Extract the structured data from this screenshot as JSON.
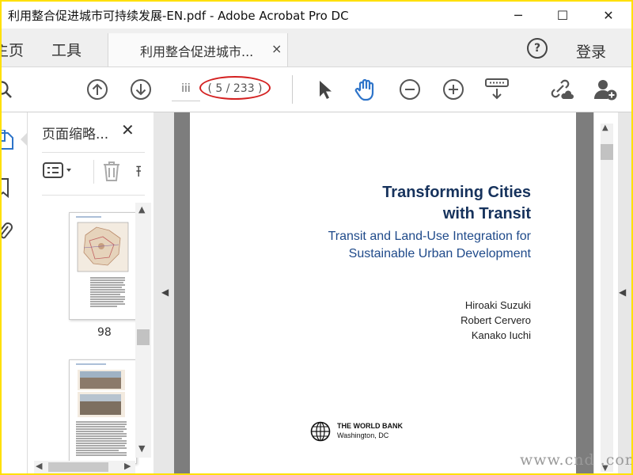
{
  "window": {
    "title": "利用整合促进城市可持续发展-EN.pdf - Adobe Acrobat Pro DC",
    "minimize_glyph": "─",
    "maximize_glyph": "☐",
    "close_glyph": "✕"
  },
  "tabs": {
    "home_label": "主页",
    "tools_label": "工具",
    "document_label": "利用整合促进城市...",
    "document_close_glyph": "×",
    "help_glyph": "?",
    "login_label": "登录"
  },
  "toolbar": {
    "current_page": "iii",
    "page_count": "( 5 / 233 )",
    "icons": [
      "search-icon",
      "page-up-icon",
      "page-down-icon",
      "select-cursor-icon",
      "hand-tool-icon",
      "zoom-out-icon",
      "zoom-in-icon",
      "scroll-mode-icon",
      "link-cloud-icon",
      "add-user-icon"
    ]
  },
  "thumbnail_panel": {
    "title": "页面缩略...",
    "close_glyph": "✕",
    "thumbnails": [
      {
        "page_label": "98"
      },
      {
        "page_label": ""
      }
    ]
  },
  "document": {
    "title_line1": "Transforming Cities",
    "title_line2": "with Transit",
    "subtitle_line1": "Transit and Land-Use Integration for",
    "subtitle_line2": "Sustainable Urban Development",
    "authors": [
      "Hiroaki Suzuki",
      "Robert Cervero",
      "Kanako Iuchi"
    ],
    "publisher": "THE WORLD BANK",
    "publisher_city": "Washington, DC"
  },
  "watermark": "www.cnd  .com",
  "colors": {
    "accent_blue": "#2e74c9",
    "title_navy": "#16325c",
    "subtitle_blue": "#1f4a8a",
    "highlight_oval": "#d42020",
    "frame_yellow": "#ffe000"
  }
}
